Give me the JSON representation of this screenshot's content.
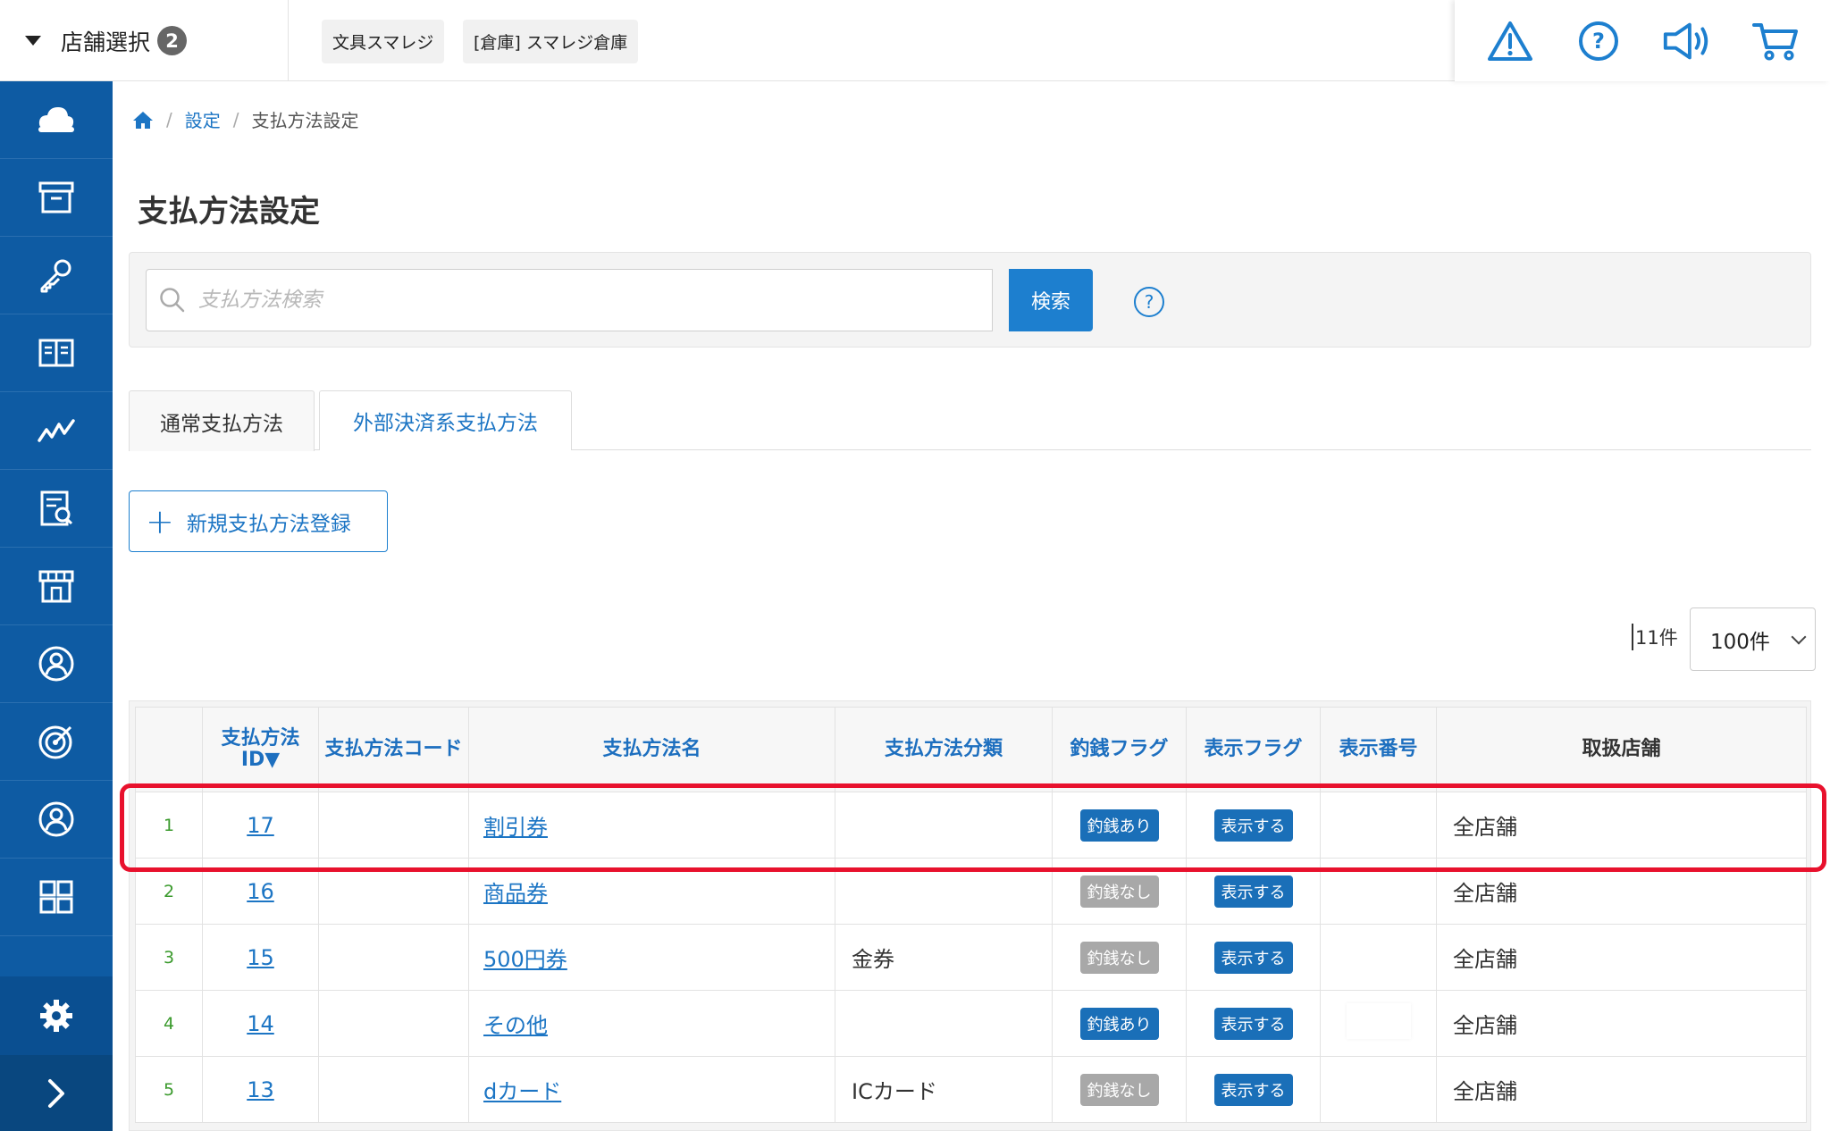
{
  "topbar": {
    "store_select_label": "店舗選択",
    "store_count": "2",
    "chips": [
      "文具スマレジ",
      "[倉庫] スマレジ倉庫"
    ],
    "icons": [
      "warning-icon",
      "help-icon",
      "announcement-icon",
      "cart-icon"
    ]
  },
  "sidebar": {
    "items": [
      "cloud-icon",
      "archive-box-icon",
      "key-icon",
      "book-icon",
      "chart-line-icon",
      "report-icon",
      "store-icon",
      "user-icon",
      "target-icon",
      "member-icon",
      "apps-grid-icon"
    ],
    "bottom": [
      "gear-icon",
      "expand-icon"
    ]
  },
  "breadcrumb": {
    "home_icon": "home-icon",
    "separator": "/",
    "settings": "設定",
    "current": "支払方法設定"
  },
  "page_title": "支払方法設定",
  "search": {
    "placeholder": "支払方法検索",
    "value": "",
    "button": "検索",
    "help": "?"
  },
  "tabs": {
    "normal": "通常支払方法",
    "external": "外部決済系支払方法"
  },
  "new_button": "新規支払方法登録",
  "list": {
    "count": "11件",
    "per_page": "100件"
  },
  "table": {
    "headers": {
      "id": "支払方法ID▼",
      "code": "支払方法コード",
      "name": "支払方法名",
      "category": "支払方法分類",
      "change_flag": "釣銭フラグ",
      "display_flag": "表示フラグ",
      "display_no": "表示番号",
      "stores": "取扱店舗"
    },
    "rows": [
      {
        "no": "1",
        "id": "17",
        "code": "",
        "name": "割引券",
        "category": "",
        "change": "釣銭あり",
        "display": "表示する",
        "display_no": "",
        "stores": "全店舗"
      },
      {
        "no": "2",
        "id": "16",
        "code": "",
        "name": "商品券",
        "category": "",
        "change": "釣銭なし",
        "display": "表示する",
        "display_no": "",
        "stores": "全店舗"
      },
      {
        "no": "3",
        "id": "15",
        "code": "",
        "name": "500円券",
        "category": "金券",
        "change": "釣銭なし",
        "display": "表示する",
        "display_no": "",
        "stores": "全店舗"
      },
      {
        "no": "4",
        "id": "14",
        "code": "",
        "name": "その他",
        "category": "",
        "change": "釣銭あり",
        "display": "表示する",
        "display_no": "",
        "stores": "全店舗"
      },
      {
        "no": "5",
        "id": "13",
        "code": "",
        "name": "dカード",
        "category": "ICカード",
        "change": "釣銭なし",
        "display": "表示する",
        "display_no": "",
        "stores": "全店舗"
      }
    ]
  },
  "colors": {
    "sidebar": "#0e5ba3",
    "accent": "#1d7fcf",
    "highlight": "#e8112d",
    "pill_on": "#1a6fb8",
    "pill_off": "#a8a8a8"
  }
}
